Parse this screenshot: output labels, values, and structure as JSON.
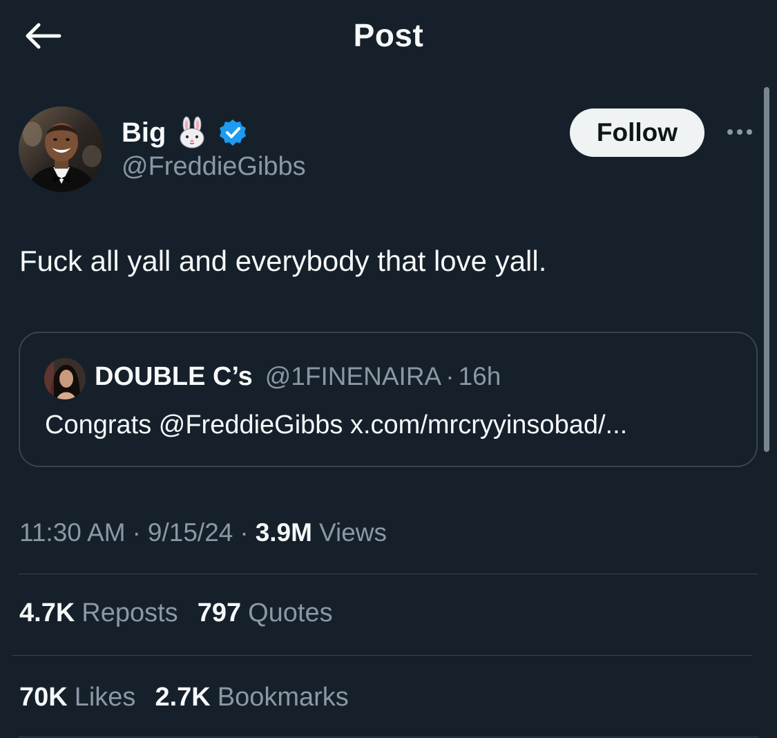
{
  "header": {
    "title": "Post",
    "back_icon": "arrow-left-icon"
  },
  "author": {
    "display_name": "Big",
    "emoji": "rabbit-face",
    "verified": true,
    "handle": "@FreddieGibbs",
    "follow_label": "Follow",
    "more_icon": "more-horizontal-icon"
  },
  "post": {
    "text": "Fuck all yall and everybody that love yall."
  },
  "quote": {
    "name": "DOUBLE C’s",
    "handle": "@1FINENAIRA",
    "separator": "·",
    "time": "16h",
    "text": "Congrats @FreddieGibbs x.com/mrcryyinsobad/..."
  },
  "meta": {
    "time": "11:30 AM",
    "date": "9/15/24",
    "separator": "·",
    "views_count": "3.9M",
    "views_label": "Views"
  },
  "stats": {
    "reposts": {
      "count": "4.7K",
      "label": "Reposts"
    },
    "quotes": {
      "count": "797",
      "label": "Quotes"
    },
    "likes": {
      "count": "70K",
      "label": "Likes"
    },
    "bookmarks": {
      "count": "2.7K",
      "label": "Bookmarks"
    }
  },
  "colors": {
    "background": "#15202b",
    "primary_text": "#f7f9f9",
    "secondary_text": "#8b98a5",
    "border": "#38444d",
    "verified_blue": "#1d9bf0",
    "follow_bg": "#eff3f4"
  }
}
